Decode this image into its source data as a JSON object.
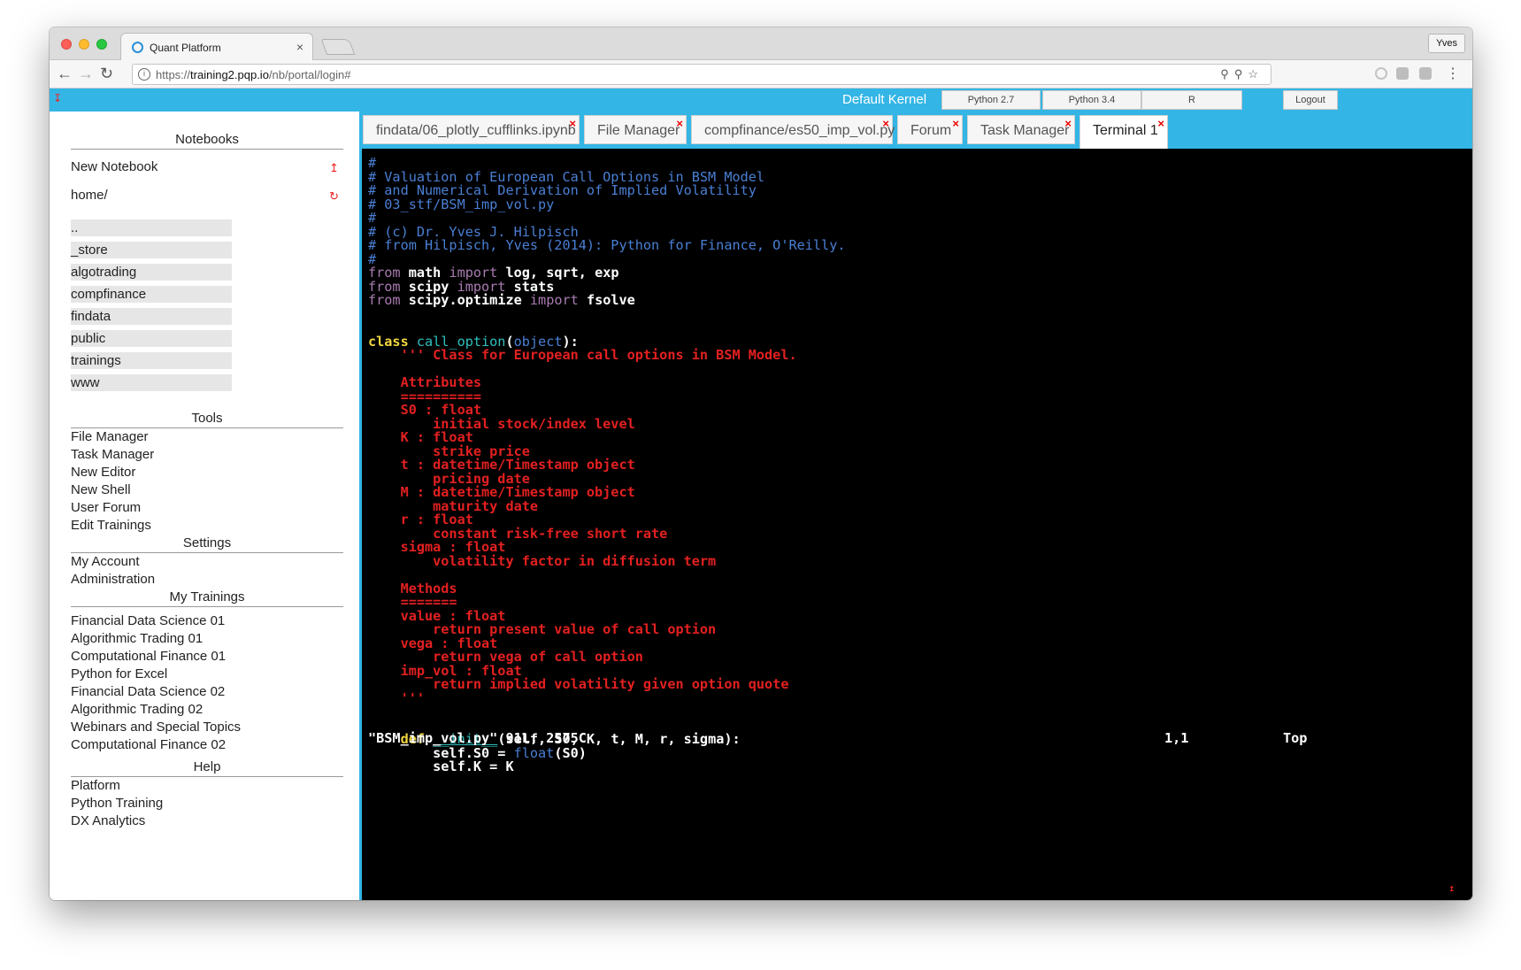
{
  "browser": {
    "tab_title": "Quant Platform",
    "tab_close": "×",
    "profile": "Yves",
    "url_scheme": "https://",
    "url_host": "training2.pqp.io",
    "url_path": "/nb/portal/login#"
  },
  "header": {
    "kernel_label": "Default Kernel",
    "kernels": [
      "Python 2.7",
      "Python 3.4",
      "R"
    ],
    "logout": "Logout"
  },
  "sidebar": {
    "notebooks_title": "Notebooks",
    "new_notebook": "New Notebook",
    "home": "home/",
    "folders": [
      "..",
      "_store",
      "algotrading",
      "compfinance",
      "findata",
      "public",
      "trainings",
      "www"
    ],
    "tools_title": "Tools",
    "tools": [
      "File Manager",
      "Task Manager",
      "New Editor",
      "New Shell",
      "User Forum",
      "Edit Trainings"
    ],
    "settings_title": "Settings",
    "settings": [
      "My Account",
      "Administration"
    ],
    "trainings_title": "My Trainings",
    "trainings": [
      "Financial Data Science 01",
      "Algorithmic Trading 01",
      "Computational Finance 01",
      "Python for Excel",
      "Financial Data Science 02",
      "Algorithmic Trading 02",
      "Webinars and Special Topics",
      "Computational Finance 02"
    ],
    "help_title": "Help",
    "help": [
      "Platform",
      "Python Training",
      "DX Analytics"
    ]
  },
  "tabs": [
    "findata/06_plotly_cufflinks.ipynb",
    "File Manager",
    "compfinance/es50_imp_vol.py",
    "Forum",
    "Task Manager",
    "Terminal 1"
  ],
  "tab_close": "×",
  "terminal": {
    "comments": [
      "#",
      "# Valuation of European Call Options in BSM Model",
      "# and Numerical Derivation of Implied Volatility",
      "# 03_stf/BSM_imp_vol.py",
      "#",
      "# (c) Dr. Yves J. Hilpisch",
      "# from Hilpisch, Yves (2014): Python for Finance, O'Reilly.",
      "#"
    ],
    "imports": [
      {
        "from": "from",
        "module": "math",
        "kw": "import",
        "names": "log, sqrt, exp"
      },
      {
        "from": "from",
        "module": "scipy",
        "kw": "import",
        "names": "stats"
      },
      {
        "from": "from",
        "module": "scipy.optimize",
        "kw": "import",
        "names": "fsolve"
      }
    ],
    "class_kw": "class",
    "class_name": "call_option",
    "class_base": "object",
    "class_open": "(",
    "class_close": "):",
    "docstring": [
      "    ''' Class for European call options in BSM Model.",
      "",
      "    Attributes",
      "    ==========",
      "    S0 : float",
      "        initial stock/index level",
      "    K : float",
      "        strike price",
      "    t : datetime/Timestamp object",
      "        pricing date",
      "    M : datetime/Timestamp object",
      "        maturity date",
      "    r : float",
      "        constant risk-free short rate",
      "    sigma : float",
      "        volatility factor in diffusion term",
      "",
      "    Methods",
      "    =======",
      "    value : float",
      "        return present value of call option",
      "    vega : float",
      "        return vega of call option",
      "    imp_vol : float",
      "        return implied volatility given option quote",
      "    '''"
    ],
    "def_kw": "    def",
    "def_name": "__init__",
    "def_args": "(self, S0, K, t, M, r, sigma):",
    "body1_a": "        self.S0 = ",
    "body1_fn": "float",
    "body1_b": "(S0)",
    "body2": "        self.K = K",
    "status_file": "\"BSM_imp_vol.py\" 91L, 2575C",
    "status_pos": "1,1",
    "status_top": "Top"
  }
}
